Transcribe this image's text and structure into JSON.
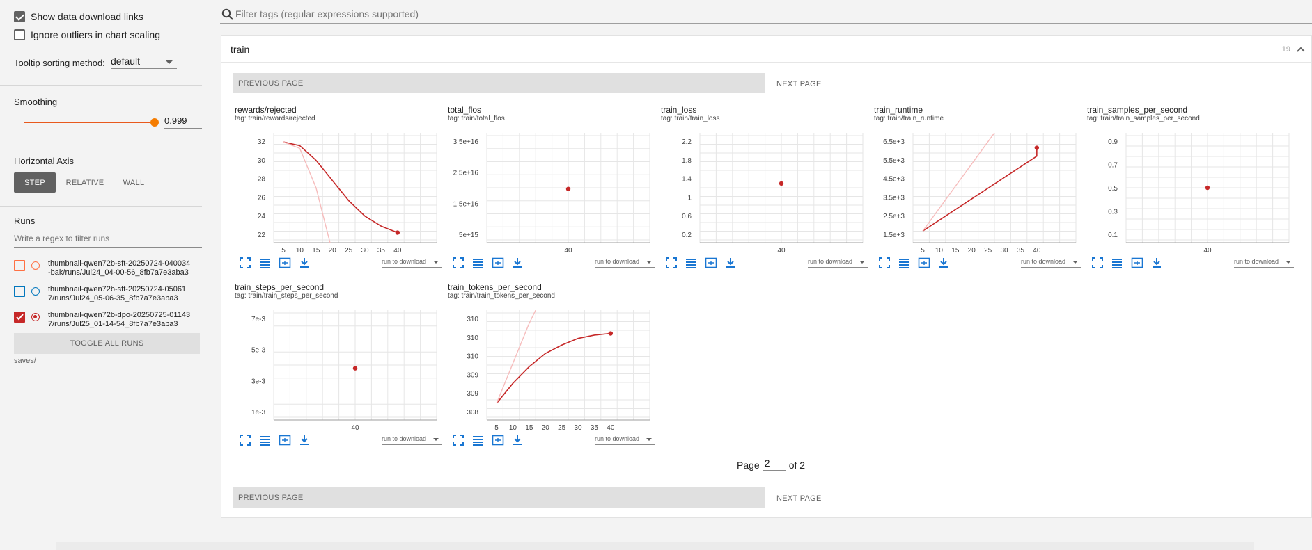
{
  "sidebar": {
    "show_download_label": "Show data download links",
    "ignore_outliers_label": "Ignore outliers in chart scaling",
    "tooltip_label": "Tooltip sorting method:",
    "tooltip_value": "default",
    "smoothing_label": "Smoothing",
    "smoothing_value": "0.999",
    "smoothing_level": 0.999,
    "axis_label": "Horizontal Axis",
    "axis_options": [
      "STEP",
      "RELATIVE",
      "WALL"
    ],
    "axis_selected": "STEP",
    "runs_label": "Runs",
    "runs_filter_placeholder": "Write a regex to filter runs",
    "runs": [
      {
        "line1": "thumbnail-qwen72b-sft-20250724-040034",
        "line2": "-bak/runs/Jul24_04-00-56_8fb7a7e3aba3",
        "color": "#ff7043",
        "checked": false,
        "radio": false
      },
      {
        "line1": "thumbnail-qwen72b-sft-20250724-05061",
        "line2": "7/runs/Jul24_05-06-35_8fb7a7e3aba3",
        "color": "#0277bd",
        "checked": false,
        "radio": false
      },
      {
        "line1": "thumbnail-qwen72b-dpo-20250725-01143",
        "line2": "7/runs/Jul25_01-14-54_8fb7a7e3aba3",
        "color": "#c62828",
        "checked": true,
        "radio": true
      }
    ],
    "toggle_all": "TOGGLE ALL RUNS",
    "log_dir": "saves/"
  },
  "filter": {
    "placeholder": "Filter tags (regular expressions supported)"
  },
  "group": {
    "title": "train",
    "count": "19"
  },
  "nav": {
    "previous": "PREVIOUS PAGE",
    "next": "NEXT PAGE"
  },
  "pager": {
    "page_label": "Page",
    "current": "2",
    "of_label": "of 2"
  },
  "run_download_label": "run to download",
  "colors": {
    "run_line": "#c62828",
    "run_raw": "#f6bcbc",
    "grid": "#e6e6e6",
    "icon_blue": "#1976d2"
  },
  "chart_data": [
    {
      "type": "line",
      "title": "rewards/rejected",
      "tag": "tag: train/rewards/rejected",
      "x_ticks": [
        "5",
        "10",
        "15",
        "20",
        "25",
        "30",
        "35",
        "40"
      ],
      "y_ticks": [
        "32",
        "30",
        "28",
        "26",
        "24",
        "22"
      ],
      "xlim": [
        2,
        52
      ],
      "ylim": [
        21,
        33
      ],
      "series": [
        {
          "x": [
            5,
            10,
            15,
            20,
            25,
            30,
            35,
            40
          ],
          "y": [
            32.0,
            31.6,
            30.0,
            27.8,
            25.6,
            23.9,
            22.8,
            22.1
          ],
          "style": "smoothed"
        },
        {
          "x": [
            5,
            10,
            15,
            20
          ],
          "y": [
            32.0,
            31.3,
            27.0,
            20.0
          ],
          "style": "raw"
        }
      ],
      "endpoint": [
        40,
        22.1
      ]
    },
    {
      "type": "scatter",
      "title": "total_flos",
      "tag": "tag: train/total_flos",
      "x_ticks": [
        "40"
      ],
      "y_ticks": [
        "3.5e+16",
        "2.5e+16",
        "1.5e+16",
        "5e+15"
      ],
      "xlim": [
        0,
        80
      ],
      "ylim": [
        0,
        4.5e+16
      ],
      "series": [
        {
          "x": [
            40
          ],
          "y": [
            2.2e+16
          ]
        }
      ],
      "endpoint": [
        40,
        2.2e+16
      ]
    },
    {
      "type": "scatter",
      "title": "train_loss",
      "tag": "tag: train/train_loss",
      "x_ticks": [
        "40"
      ],
      "y_ticks": [
        "2.2",
        "1.8",
        "1.4",
        "1",
        "0.6",
        "0.2"
      ],
      "xlim": [
        0,
        80
      ],
      "ylim": [
        -0.2,
        2.4
      ],
      "series": [
        {
          "x": [
            40
          ],
          "y": [
            1.2
          ]
        }
      ],
      "endpoint": [
        40,
        1.2
      ]
    },
    {
      "type": "line",
      "title": "train_runtime",
      "tag": "tag: train/train_runtime",
      "x_ticks": [
        "5",
        "10",
        "15",
        "20",
        "25",
        "30",
        "35",
        "40"
      ],
      "y_ticks": [
        "6.5e+3",
        "5.5e+3",
        "4.5e+3",
        "3.5e+3",
        "2.5e+3",
        "1.5e+3"
      ],
      "xlim": [
        2,
        52
      ],
      "ylim": [
        600,
        7200
      ],
      "series": [
        {
          "x": [
            5,
            40,
            40
          ],
          "y": [
            1300,
            5800,
            6300
          ],
          "style": "smoothed"
        },
        {
          "x": [
            5,
            27
          ],
          "y": [
            1300,
            7200
          ],
          "style": "raw"
        }
      ],
      "endpoint": [
        40,
        6300
      ]
    },
    {
      "type": "scatter",
      "title": "train_samples_per_second",
      "tag": "tag: train/train_samples_per_second",
      "x_ticks": [
        "40"
      ],
      "y_ticks": [
        "0.9",
        "0.7",
        "0.5",
        "0.3",
        "0.1"
      ],
      "xlim": [
        0,
        80
      ],
      "ylim": [
        0.0,
        1.0
      ],
      "series": [
        {
          "x": [
            40
          ],
          "y": [
            0.5
          ]
        }
      ],
      "endpoint": [
        40,
        0.5
      ]
    },
    {
      "type": "scatter",
      "title": "train_steps_per_second",
      "tag": "tag: train/train_steps_per_second",
      "x_ticks": [
        "40"
      ],
      "y_ticks": [
        "7e-3",
        "5e-3",
        "3e-3",
        "1e-3"
      ],
      "xlim": [
        0,
        80
      ],
      "ylim": [
        0.0,
        0.0085
      ],
      "series": [
        {
          "x": [
            40
          ],
          "y": [
            0.004
          ]
        }
      ],
      "endpoint": [
        40,
        0.004
      ]
    },
    {
      "type": "line",
      "title": "train_tokens_per_second",
      "tag": "tag: train/train_tokens_per_second",
      "x_ticks": [
        "5",
        "10",
        "15",
        "20",
        "25",
        "30",
        "35",
        "40"
      ],
      "y_ticks": [
        "310",
        "310",
        "310",
        "309",
        "309",
        "308"
      ],
      "xlim": [
        2,
        52
      ],
      "ylim": [
        307.6,
        310.9
      ],
      "series": [
        {
          "x": [
            5,
            10,
            15,
            20,
            25,
            30,
            35,
            40
          ],
          "y": [
            308.1,
            308.7,
            309.2,
            309.6,
            309.85,
            310.05,
            310.15,
            310.2
          ],
          "style": "smoothed"
        },
        {
          "x": [
            5,
            10,
            15,
            17
          ],
          "y": [
            308.1,
            309.3,
            310.5,
            310.9
          ],
          "style": "raw"
        }
      ],
      "endpoint": [
        40,
        310.2
      ]
    }
  ]
}
